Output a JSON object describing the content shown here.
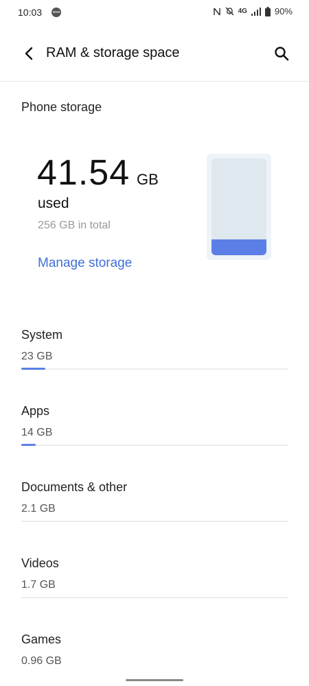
{
  "status_bar": {
    "time": "10:03",
    "app_icon": "weather-app-icon",
    "network": "4G",
    "battery": "90%"
  },
  "header": {
    "title": "RAM & storage space",
    "back_icon": "back-arrow-icon",
    "search_icon": "search-icon"
  },
  "phone_storage": {
    "section_title": "Phone storage",
    "used_value": "41.54",
    "used_unit": "GB",
    "used_label": "used",
    "total_label": "256 GB in total",
    "manage_label": "Manage storage",
    "used_fraction": 0.16
  },
  "categories": [
    {
      "name": "System",
      "size": "23 GB",
      "fraction": 0.09
    },
    {
      "name": "Apps",
      "size": "14 GB",
      "fraction": 0.055
    },
    {
      "name": "Documents & other",
      "size": "2.1 GB",
      "fraction": 0.0
    },
    {
      "name": "Videos",
      "size": "1.7 GB",
      "fraction": 0.0
    },
    {
      "name": "Games",
      "size": "0.96 GB",
      "fraction": 0.0
    }
  ],
  "colors": {
    "accent": "#5b7fe6",
    "link": "#3f6fd8"
  }
}
